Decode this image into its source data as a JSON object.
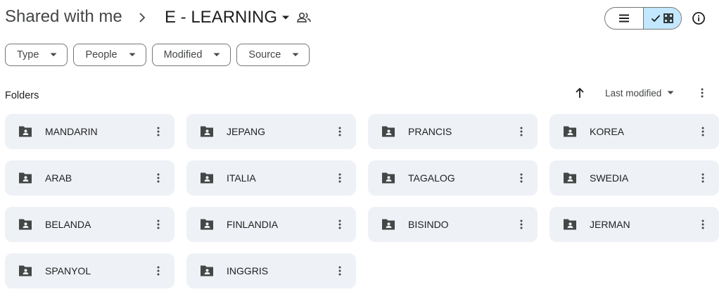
{
  "breadcrumb": {
    "root": "Shared with me",
    "current": "E - LEARNING"
  },
  "icons": {
    "separator": "chevron-right-icon",
    "current_dropdown": "caret-down-icon",
    "shared": "people-icon",
    "list_view": "list-view-icon",
    "grid_view": "grid-view-icon",
    "check": "check-icon",
    "info": "info-icon",
    "folder": "shared-folder-icon",
    "more": "more-vert-icon",
    "sort_direction": "arrow-up-icon"
  },
  "view_toggle": {
    "selected": "grid"
  },
  "filters": [
    {
      "label": "Type"
    },
    {
      "label": "People"
    },
    {
      "label": "Modified"
    },
    {
      "label": "Source"
    }
  ],
  "folders_section": {
    "title": "Folders",
    "sort_label": "Last modified",
    "sort_direction": "ascending"
  },
  "folders": [
    {
      "name": "MANDARIN"
    },
    {
      "name": "JEPANG"
    },
    {
      "name": "PRANCIS"
    },
    {
      "name": "KOREA"
    },
    {
      "name": "ARAB"
    },
    {
      "name": "ITALIA"
    },
    {
      "name": "TAGALOG"
    },
    {
      "name": "SWEDIA"
    },
    {
      "name": "BELANDA"
    },
    {
      "name": "FINLANDIA"
    },
    {
      "name": "BISINDO"
    },
    {
      "name": "JERMAN"
    },
    {
      "name": "SPANYOL"
    },
    {
      "name": "INGGRIS"
    }
  ],
  "colors": {
    "card_bg": "#eef1f6",
    "selected_toggle": "#c2e7ff",
    "icon": "#444746",
    "text": "#1f1f1f",
    "border": "#747775"
  }
}
